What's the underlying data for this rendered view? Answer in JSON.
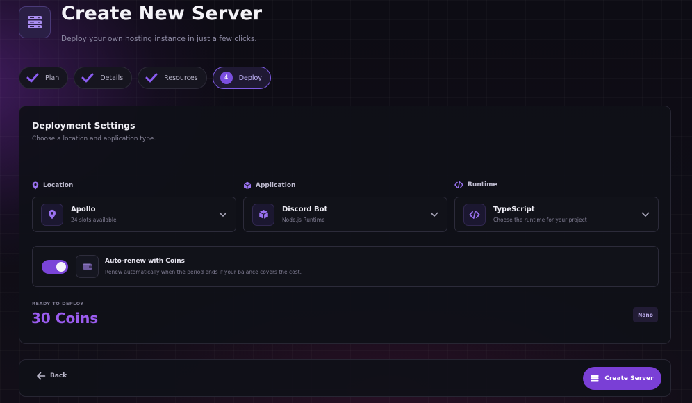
{
  "header": {
    "title": "Create New Server",
    "subtitle": "Deploy your own hosting instance in just a few clicks.",
    "icon": "server-icon"
  },
  "steps": [
    {
      "label": "Plan",
      "state": "done"
    },
    {
      "label": "Details",
      "state": "done"
    },
    {
      "label": "Resources",
      "state": "done"
    },
    {
      "label": "Deploy",
      "number": "4",
      "state": "active"
    }
  ],
  "settings": {
    "title": "Deployment Settings",
    "subtitle": "Choose a location and application type.",
    "location": {
      "label": "Location",
      "value": "Apollo",
      "detail": "24 slots available",
      "icon": "map-pin-icon"
    },
    "application": {
      "label": "Application",
      "value": "Discord Bot",
      "detail": "Node.js Runtime",
      "icon": "cube-icon"
    },
    "runtime": {
      "label": "Runtime",
      "value": "TypeScript",
      "detail": "Choose the runtime for your project",
      "icon": "code-icon"
    },
    "autorenew": {
      "title": "Auto-renew with Coins",
      "description": "Renew automatically when the period ends if your balance covers the cost.",
      "enabled": true
    },
    "summary": {
      "status": "READY TO DEPLOY",
      "price": "30 Coins",
      "plan_badge": "Nano"
    }
  },
  "footer": {
    "back_label": "Back",
    "create_label": "Create Server"
  },
  "colors": {
    "accent": "#7a3fd6",
    "price": "#9b5cf0",
    "background": "#0d0c14"
  }
}
